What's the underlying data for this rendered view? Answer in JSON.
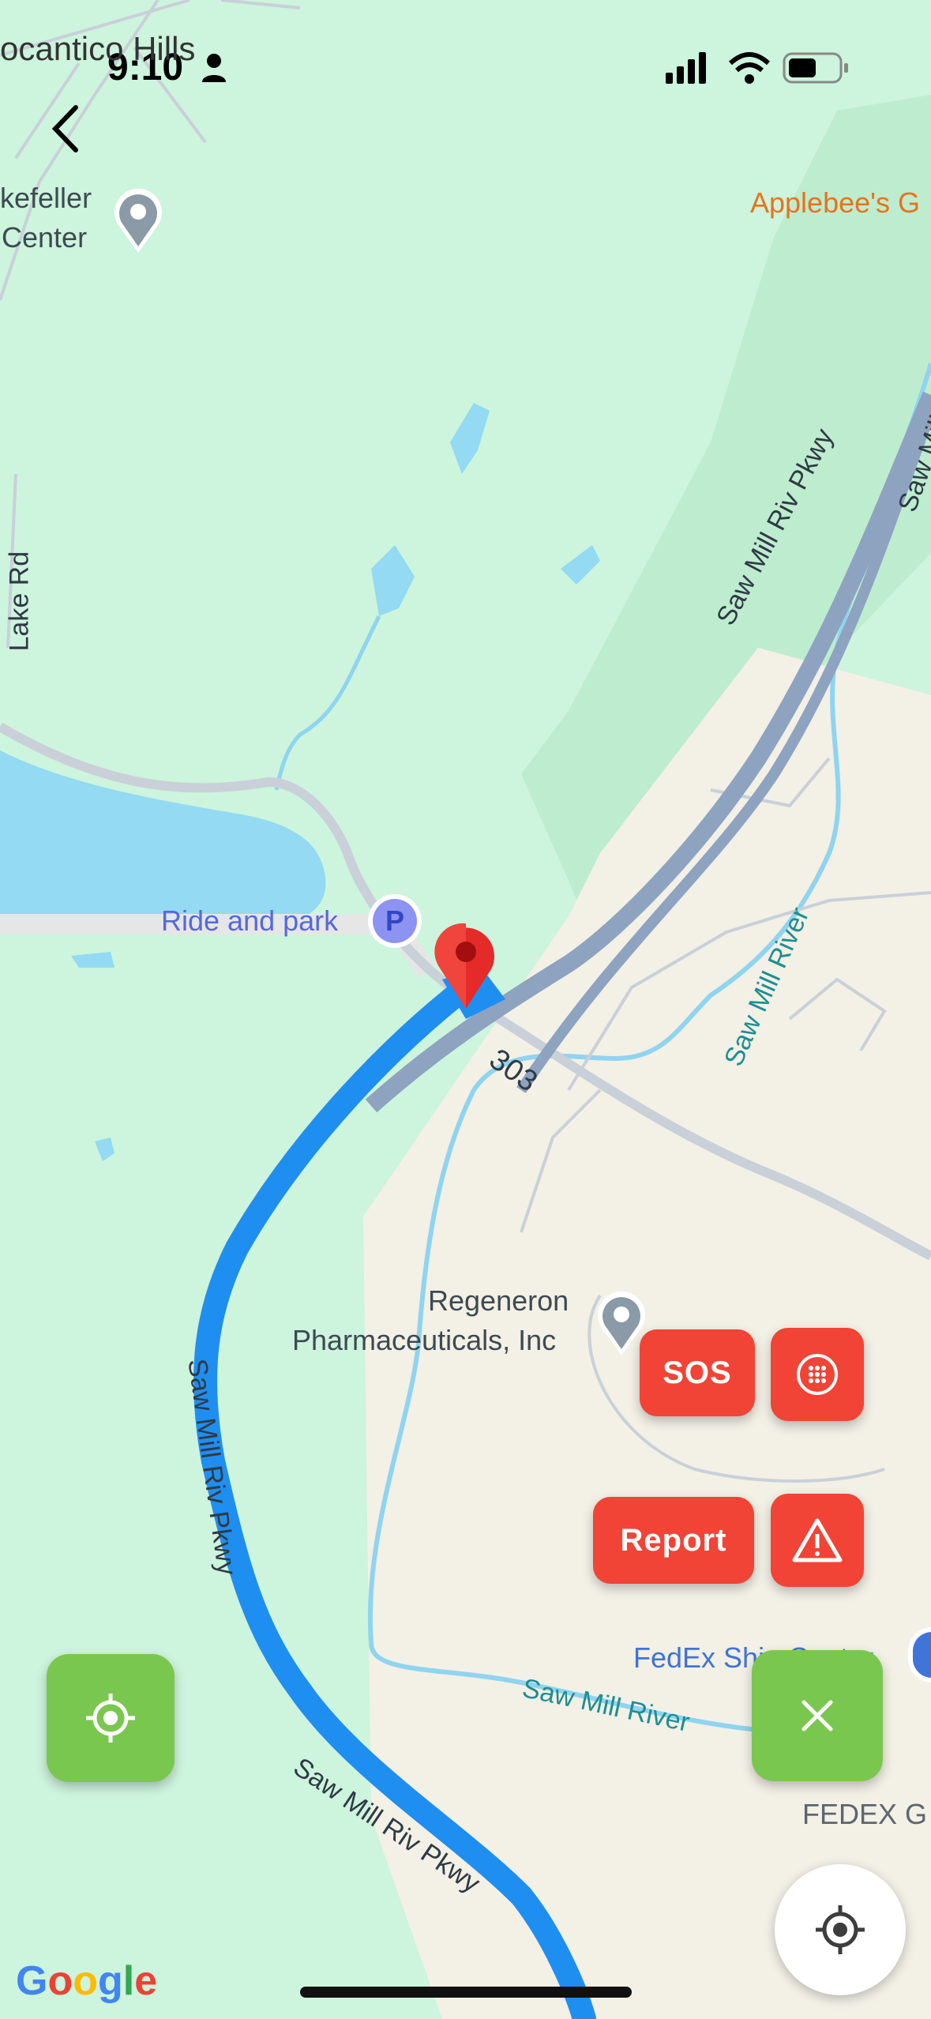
{
  "status_bar": {
    "time": "9:10"
  },
  "map": {
    "places": {
      "pocantico": "ocantico Hills",
      "rockefeller_line1": "kefeller",
      "rockefeller_line2": "Center",
      "applebees": "Applebee's G",
      "lake_rd": "Lake Rd",
      "ride_and_park": "Ride and park",
      "regeneron_line1": "Regeneron",
      "regeneron_line2": "Pharmaceuticals, Inc",
      "fedex_ship": "FedEx Ship Center",
      "fedex_g": "FEDEX G",
      "route_303": "303"
    },
    "roads": {
      "saw_mill_upper": "Saw Mill Riv Pkwy",
      "saw_mill_top_edge": "Saw Mill",
      "saw_mill_left": "Saw Mill Riv Pkwy",
      "saw_mill_bottom": "Saw Mill Riv Pkwy"
    },
    "rivers": {
      "saw_mill_river_upper": "Saw Mill River",
      "saw_mill_river_lower": "Saw Mill River"
    },
    "parking_badge": "P"
  },
  "actions": {
    "sos_label": "SOS",
    "report_label": "Report"
  },
  "attribution": {
    "letters": [
      "G",
      "o",
      "o",
      "g",
      "l",
      "e"
    ],
    "colors": [
      "#4285F4",
      "#EA4335",
      "#FBBC05",
      "#4285F4",
      "#34A853",
      "#EA4335"
    ]
  },
  "colors": {
    "action_red": "#f14436",
    "action_green": "#7ac74f",
    "route_blue": "#1f8ef1"
  },
  "icons": {
    "back": "chevron-left-icon",
    "parking": "parking-icon",
    "pin": "location-pin-icon",
    "sos_grid": "dots-grid-icon",
    "warning": "warning-triangle-icon",
    "locate": "crosshair-icon",
    "close": "close-icon"
  }
}
